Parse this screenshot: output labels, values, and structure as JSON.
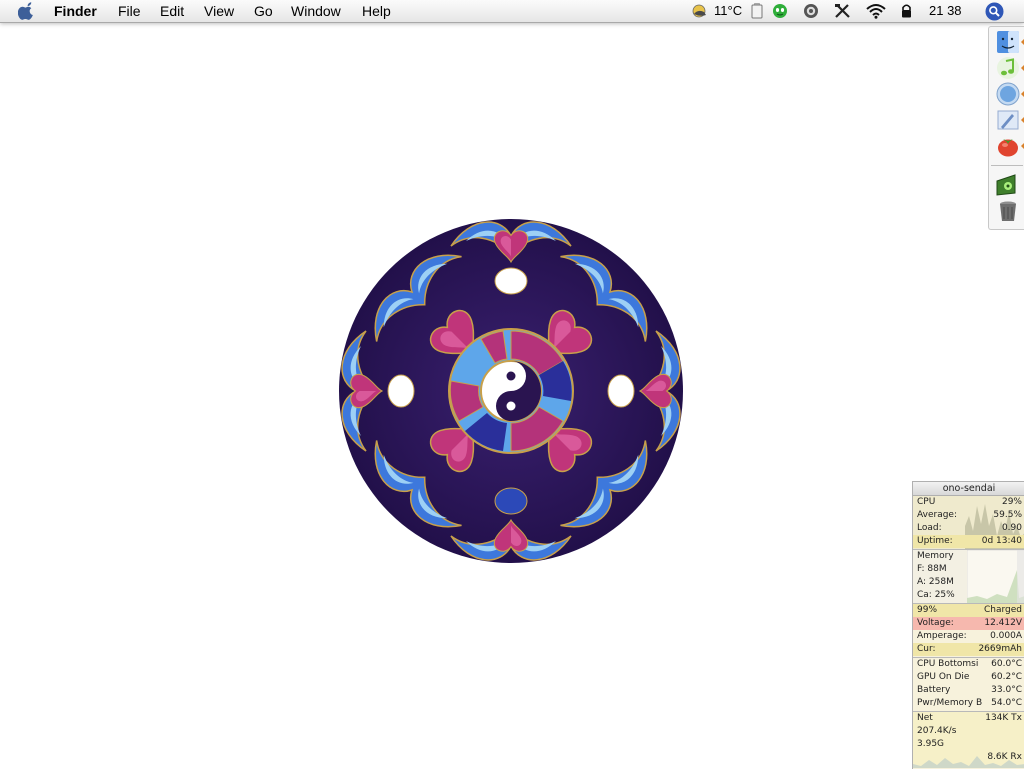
{
  "menubar": {
    "app_name": "Finder",
    "menus": [
      "File",
      "Edit",
      "View",
      "Go",
      "Window",
      "Help"
    ],
    "temperature": "11°C",
    "clock": "21 38"
  },
  "dock": {
    "items": [
      "finder-icon",
      "itunes-icon",
      "safari-icon",
      "mail-icon",
      "tomato-icon",
      "disk-app-icon",
      "trash-icon"
    ]
  },
  "monitor": {
    "hostname": "ono-sendai",
    "cpu": {
      "cpu_label": "CPU",
      "cpu_value": "29%",
      "average_label": "Average:",
      "average_value": "59.5%",
      "load_label": "Load:",
      "load_value": "0.90",
      "uptime_label": "Uptime:",
      "uptime_value": "0d 13:40"
    },
    "memory": {
      "title": "Memory",
      "free": "F: 88M",
      "active": "A: 258M",
      "cache": "Ca: 25%"
    },
    "battery": {
      "percent": "99%",
      "status": "Charged",
      "voltage_label": "Voltage:",
      "voltage_value": "12.412V",
      "amperage_label": "Amperage:",
      "amperage_value": "0.000A",
      "cur_label": "Cur:",
      "cur_value": "2669mAh"
    },
    "temps": [
      {
        "label": "CPU Bottomsi",
        "value": "60.0°C"
      },
      {
        "label": "GPU On Die",
        "value": "60.2°C"
      },
      {
        "label": "Battery",
        "value": "33.0°C"
      },
      {
        "label": "Pwr/Memory B",
        "value": "54.0°C"
      }
    ],
    "net": {
      "label": "Net",
      "tx": "134K Tx",
      "rate": "207.4K/s",
      "total": "3.95G",
      "rx": "8.6K Rx"
    }
  },
  "colors": {
    "mandala_bg": "#2a1450",
    "mandala_blue": "#3a6fd6",
    "mandala_light_blue": "#8ec4f0",
    "mandala_magenta": "#b8306e",
    "mandala_gold": "#c8a04a",
    "monitor_red": "#f6b8ae",
    "monitor_yellow": "#f0e6a8"
  }
}
